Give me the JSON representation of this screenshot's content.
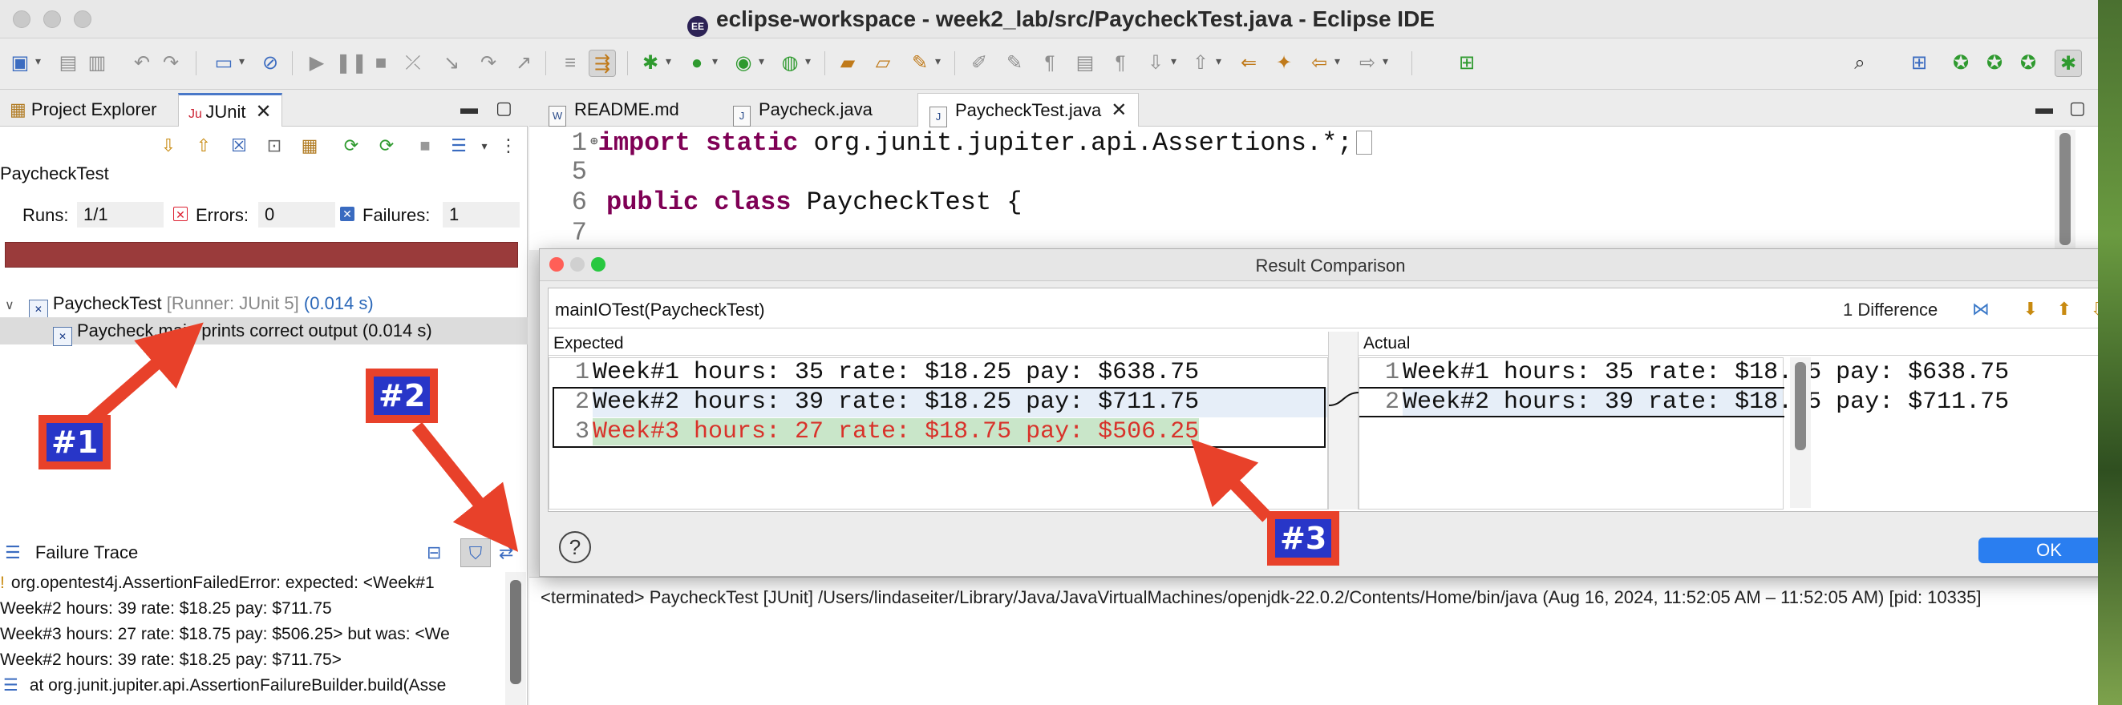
{
  "window": {
    "title": "eclipse-workspace - week2_lab/src/PaycheckTest.java - Eclipse IDE",
    "app_icon_text": "EE"
  },
  "left_panel": {
    "tabs": [
      {
        "label": "Project Explorer"
      },
      {
        "label": "JUnit"
      }
    ],
    "suite_label": "PaycheckTest",
    "counts": {
      "runs_label": "Runs:",
      "runs_value": "1/1",
      "errors_label": "Errors:",
      "errors_value": "0",
      "failures_label": "Failures:",
      "failures_value": "1"
    },
    "progress_color": "#9a3b3b",
    "tree": {
      "root_name": "PaycheckTest",
      "root_runner": "[Runner: JUnit 5]",
      "root_time": "(0.014 s)",
      "child_name": "Paycheck.main prints correct output (0.014 s)"
    },
    "failure_trace": {
      "label": "Failure Trace",
      "lines": [
        "org.opentest4j.AssertionFailedError: expected: <Week#1",
        "Week#2 hours: 39 rate: $18.25 pay: $711.75",
        "Week#3 hours: 27 rate: $18.75 pay: $506.25> but was: <We",
        "Week#2 hours: 39 rate: $18.25 pay: $711.75>",
        "at org.junit.jupiter.api.AssertionFailureBuilder.build(Asse"
      ]
    }
  },
  "editor": {
    "tabs": [
      {
        "label": "README.md"
      },
      {
        "label": "Paycheck.java"
      },
      {
        "label": "PaycheckTest.java"
      }
    ],
    "lines": [
      {
        "num": "1",
        "kw": "import static",
        "rest": " org.junit.jupiter.api.Assertions.*;"
      },
      {
        "num": "5",
        "kw": "",
        "rest": ""
      },
      {
        "num": "6",
        "kw": "public class",
        "rest": " PaycheckTest {"
      },
      {
        "num": "7",
        "kw": "",
        "rest": ""
      }
    ]
  },
  "dialog": {
    "title": "Result Comparison",
    "test_name": "mainIOTest(PaycheckTest)",
    "difference_count": "1 Difference",
    "expected_label": "Expected",
    "actual_label": "Actual",
    "expected_lines": [
      {
        "num": "1",
        "text": "Week#1 hours: 35 rate: $18.25 pay: $638.75"
      },
      {
        "num": "2",
        "text": "Week#2 hours: 39 rate: $18.25 pay: $711.75"
      },
      {
        "num": "3",
        "text": "Week#3 hours: 27 rate: $18.75 pay: $506.25"
      }
    ],
    "actual_lines": [
      {
        "num": "1",
        "text": "Week#1 hours: 35 rate: $18.25 pay: $638.75"
      },
      {
        "num": "2",
        "text": "Week#2 hours: 39 rate: $18.25 pay: $711.75"
      }
    ],
    "help_label": "?",
    "ok_label": "OK"
  },
  "console": {
    "line": "<terminated> PaycheckTest [JUnit] /Users/lindaseiter/Library/Java/JavaVirtualMachines/openjdk-22.0.2/Contents/Home/bin/java  (Aug 16, 2024, 11:52:05 AM – 11:52:05 AM) [pid: 10335]"
  },
  "annotations": {
    "badge1": "#1",
    "badge2": "#2",
    "badge3": "#3",
    "color": "#e8412a"
  }
}
